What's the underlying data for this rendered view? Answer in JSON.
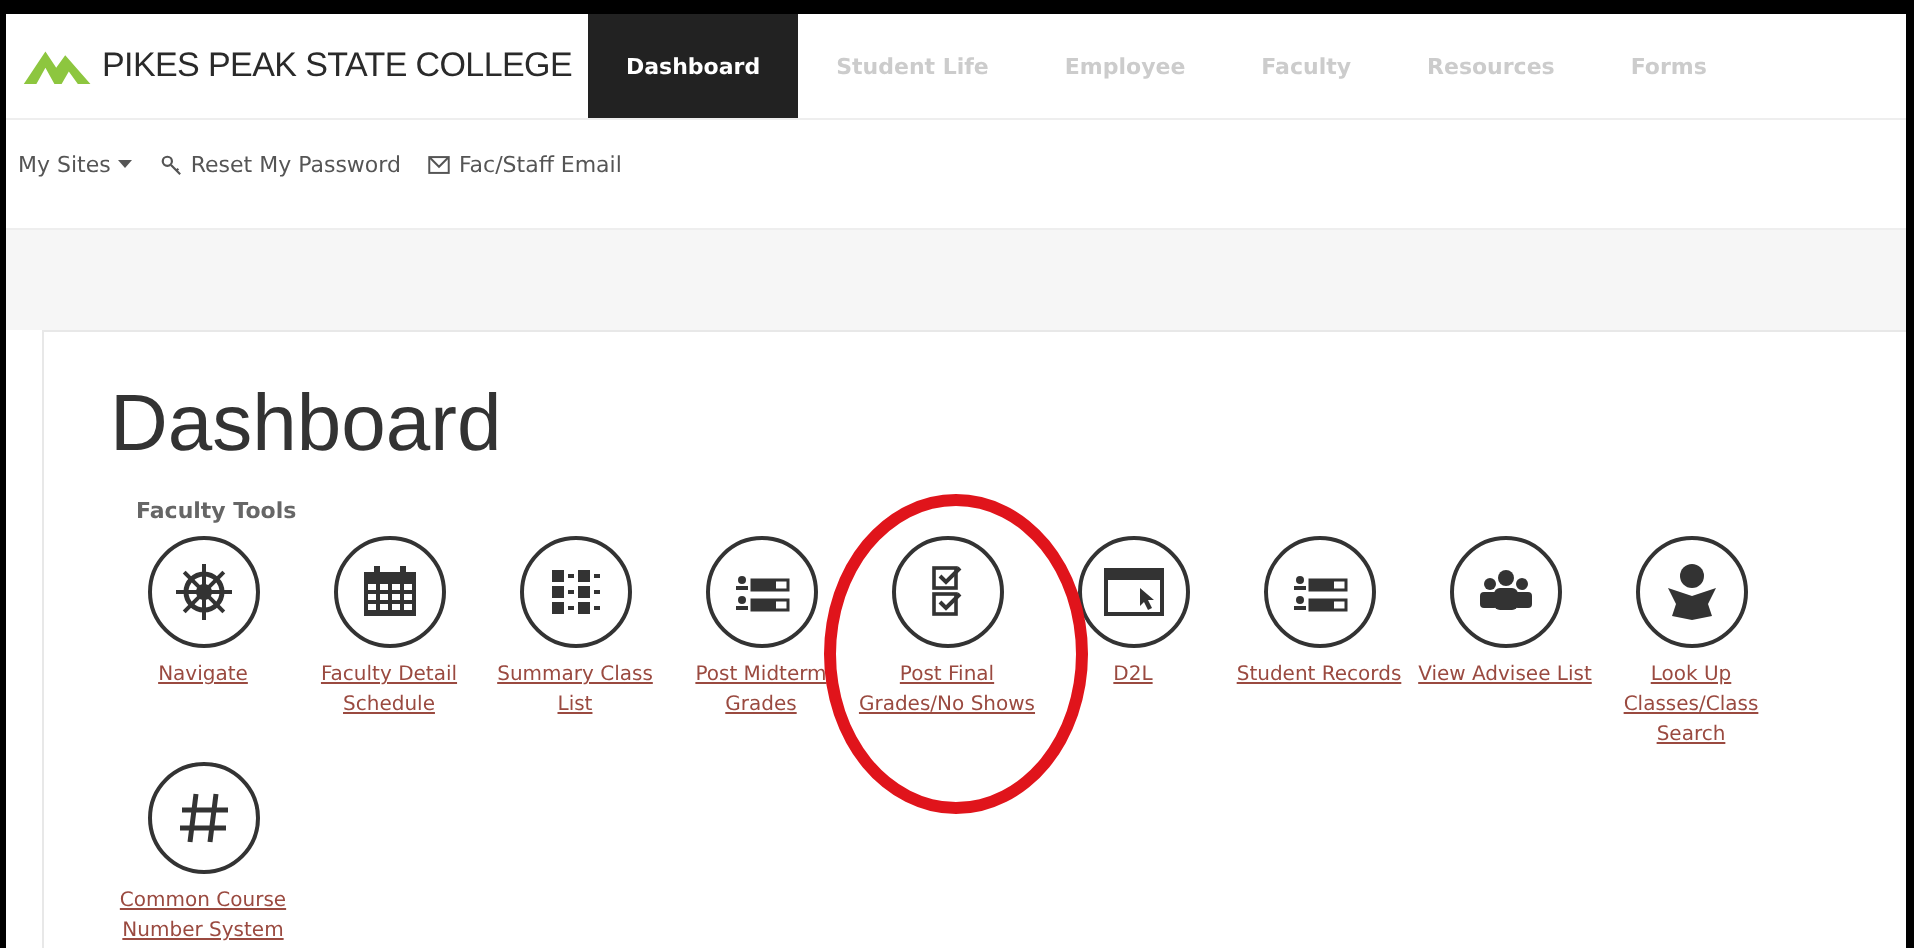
{
  "logo": {
    "text": "PIKES PEAK STATE COLLEGE"
  },
  "nav": [
    {
      "label": "Dashboard",
      "selected": true
    },
    {
      "label": "Student Life",
      "selected": false
    },
    {
      "label": "Employee",
      "selected": false
    },
    {
      "label": "Faculty",
      "selected": false
    },
    {
      "label": "Resources",
      "selected": false
    },
    {
      "label": "Forms",
      "selected": false
    }
  ],
  "subnav": [
    {
      "kind": "dropdown",
      "label": "My Sites"
    },
    {
      "kind": "key",
      "label": "Reset My Password"
    },
    {
      "kind": "mail",
      "label": "Fac/Staff Email"
    }
  ],
  "page_title": "Dashboard",
  "section_title": "Faculty Tools",
  "tools": [
    {
      "kind": "wheel",
      "label": "Navigate"
    },
    {
      "kind": "calendar",
      "label": "Faculty Detail Schedule"
    },
    {
      "kind": "list",
      "label": "Summary Class List"
    },
    {
      "kind": "records",
      "label": "Post Midterm Grades"
    },
    {
      "kind": "checks",
      "label": "Post Final Grades/No Shows"
    },
    {
      "kind": "browser",
      "label": "D2L"
    },
    {
      "kind": "records",
      "label": "Student Records"
    },
    {
      "kind": "group",
      "label": "View Advisee List"
    },
    {
      "kind": "reader",
      "label": "Look Up Classes/Class Search"
    },
    {
      "kind": "hash",
      "label": "Common Course Number System"
    }
  ],
  "annotation": {
    "kind": "circle",
    "color": "#e0141b"
  }
}
